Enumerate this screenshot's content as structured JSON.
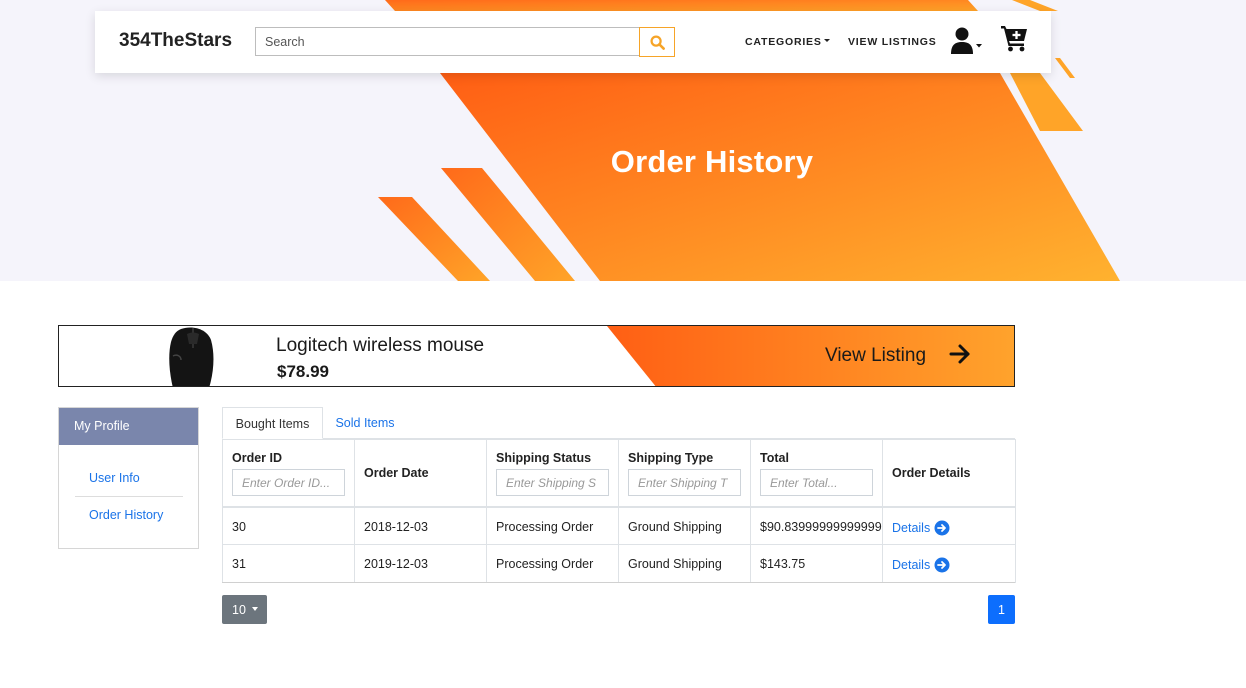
{
  "brand": "354TheStars",
  "search": {
    "placeholder": "Search"
  },
  "nav": {
    "categories": "CATEGORIES",
    "view_listings": "VIEW LISTINGS"
  },
  "hero": {
    "title": "Order History"
  },
  "promo": {
    "name": "Logitech wireless mouse",
    "price": "$78.99",
    "cta": "View Listing"
  },
  "side_menu": {
    "header": "My Profile",
    "items": [
      "User Info",
      "Order History"
    ]
  },
  "tabs": [
    "Bought Items",
    "Sold Items"
  ],
  "table": {
    "headers": [
      "Order ID",
      "Order Date",
      "Shipping Status",
      "Shipping Type",
      "Total",
      "Order Details"
    ],
    "filters": [
      "Enter Order ID...",
      "Enter Shipping S",
      "Enter Shipping T",
      "Enter Total..."
    ],
    "rows": [
      {
        "id": "30",
        "date": "2018-12-03",
        "status": "Processing Order",
        "type": "Ground Shipping",
        "total": "$90.83999999999999",
        "details": "Details"
      },
      {
        "id": "31",
        "date": "2019-12-03",
        "status": "Processing Order",
        "type": "Ground Shipping",
        "total": "$143.75",
        "details": "Details"
      }
    ]
  },
  "pagination": {
    "page_size": "10",
    "current_page": "1"
  },
  "colors": {
    "accent": "#f6a428",
    "gradient_start": "#ff6a1a",
    "gradient_end": "#ffae2e",
    "link": "#1a73e8",
    "profile_header": "#7a86ac"
  },
  "icons": {
    "search": "search-icon",
    "user": "user-icon",
    "cart": "cart-plus-icon",
    "arrow": "arrow-right-icon",
    "details": "circle-arrow-right-icon"
  }
}
